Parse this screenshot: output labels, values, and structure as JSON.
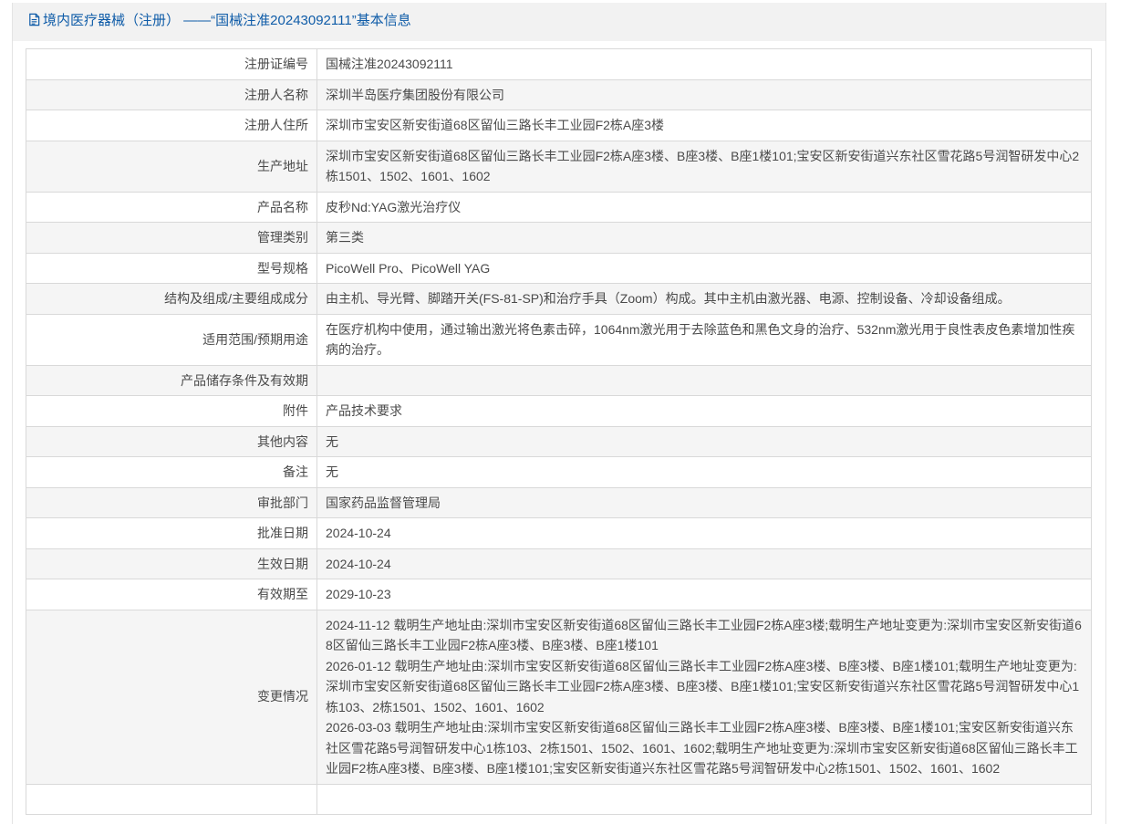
{
  "header": {
    "icon": "document-icon",
    "title": "境内医疗器械（注册） ——“国械注准20243092111”基本信息"
  },
  "rows": [
    {
      "label": "注册证编号",
      "value": "国械注准20243092111"
    },
    {
      "label": "注册人名称",
      "value": "深圳半岛医疗集团股份有限公司"
    },
    {
      "label": "注册人住所",
      "value": "深圳市宝安区新安街道68区留仙三路长丰工业园F2栋A座3楼"
    },
    {
      "label": "生产地址",
      "value": "深圳市宝安区新安街道68区留仙三路长丰工业园F2栋A座3楼、B座3楼、B座1楼101;宝安区新安街道兴东社区雪花路5号润智研发中心2栋1501、1502、1601、1602"
    },
    {
      "label": "产品名称",
      "value": "皮秒Nd:YAG激光治疗仪"
    },
    {
      "label": "管理类别",
      "value": "第三类"
    },
    {
      "label": "型号规格",
      "value": "PicoWell Pro、PicoWell YAG"
    },
    {
      "label": "结构及组成/主要组成成分",
      "value": "由主机、导光臂、脚踏开关(FS-81-SP)和治疗手具（Zoom）构成。其中主机由激光器、电源、控制设备、冷却设备组成。"
    },
    {
      "label": "适用范围/预期用途",
      "value": "在医疗机构中使用，通过输出激光将色素击碎，1064nm激光用于去除蓝色和黑色文身的治疗、532nm激光用于良性表皮色素增加性疾病的治疗。"
    },
    {
      "label": "产品储存条件及有效期",
      "value": ""
    },
    {
      "label": "附件",
      "value": "产品技术要求"
    },
    {
      "label": "其他内容",
      "value": "无"
    },
    {
      "label": "备注",
      "value": "无"
    },
    {
      "label": "审批部门",
      "value": "国家药品监督管理局"
    },
    {
      "label": "批准日期",
      "value": "2024-10-24"
    },
    {
      "label": "生效日期",
      "value": "2024-10-24"
    },
    {
      "label": "有效期至",
      "value": "2029-10-23"
    }
  ],
  "changes": {
    "label": "变更情况",
    "entries": [
      "2024-11-12 载明生产地址由:深圳市宝安区新安街道68区留仙三路长丰工业园F2栋A座3楼;载明生产地址变更为:深圳市宝安区新安街道68区留仙三路长丰工业园F2栋A座3楼、B座3楼、B座1楼101",
      "2026-01-12 载明生产地址由:深圳市宝安区新安街道68区留仙三路长丰工业园F2栋A座3楼、B座3楼、B座1楼101;载明生产地址变更为:深圳市宝安区新安街道68区留仙三路长丰工业园F2栋A座3楼、B座3楼、B座1楼101;宝安区新安街道兴东社区雪花路5号润智研发中心1栋103、2栋1501、1502、1601、1602",
      "2026-03-03 载明生产地址由:深圳市宝安区新安街道68区留仙三路长丰工业园F2栋A座3楼、B座3楼、B座1楼101;宝安区新安街道兴东社区雪花路5号润智研发中心1栋103、2栋1501、1502、1601、1602;载明生产地址变更为:深圳市宝安区新安街道68区留仙三路长丰工业园F2栋A座3楼、B座3楼、B座1楼101;宝安区新安街道兴东社区雪花路5号润智研发中心2栋1501、1502、1601、1602"
    ]
  }
}
